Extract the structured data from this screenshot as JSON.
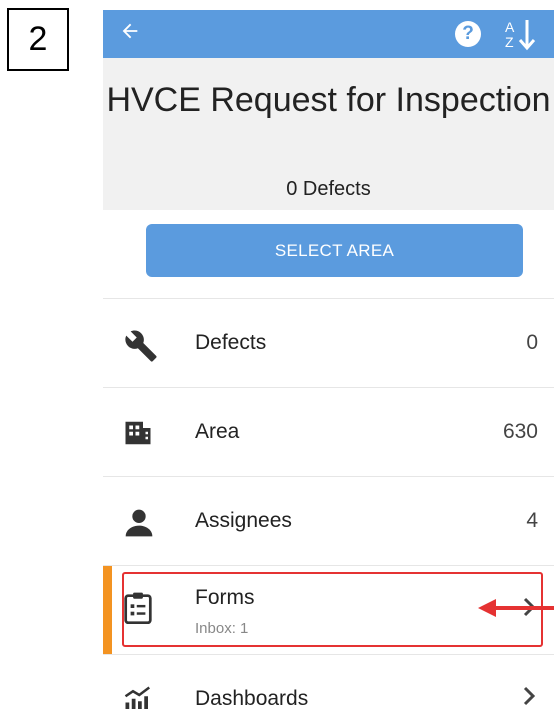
{
  "step": {
    "number": "2"
  },
  "appbar": {
    "back_icon": "arrow-left-icon",
    "help_icon": "help-circle-icon",
    "sort_icon": "sort-alpha-icon",
    "sort_a": "A",
    "sort_z": "Z",
    "color": "#5b9bde"
  },
  "header": {
    "title": "HVCE Request for Inspection",
    "subtitle": "0 Defects"
  },
  "select_area": {
    "label": "SELECT AREA"
  },
  "list": [
    {
      "label": "Defects",
      "value": "0",
      "icon": "wrench-icon"
    },
    {
      "label": "Area",
      "value": "630",
      "icon": "building-icon"
    },
    {
      "label": "Assignees",
      "value": "4",
      "icon": "person-icon"
    },
    {
      "label": "Forms",
      "sublabel": "Inbox: 1",
      "icon": "clipboard-icon",
      "accent": "#f39321"
    },
    {
      "label": "Dashboards",
      "icon": "chart-icon"
    }
  ],
  "annotation": {
    "color": "#e53232"
  }
}
